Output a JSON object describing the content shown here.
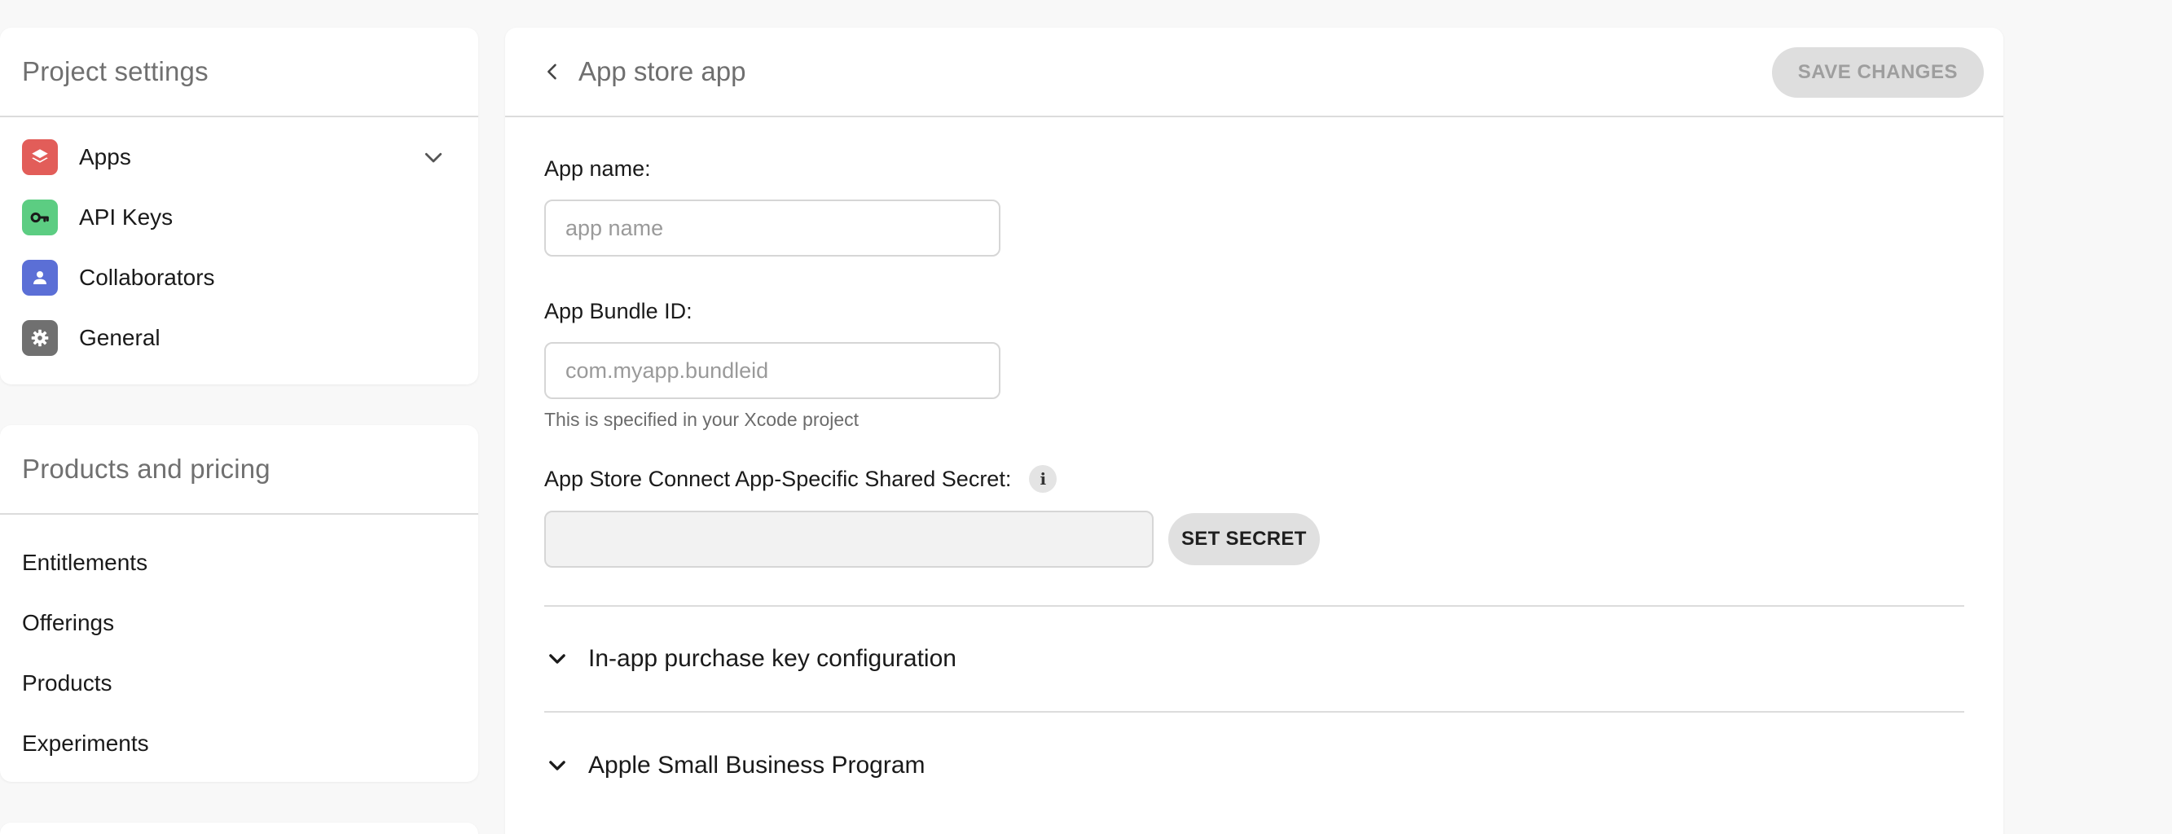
{
  "sidebar": {
    "project_settings": {
      "title": "Project settings",
      "items": [
        {
          "label": "Apps",
          "icon": "apps-stack-icon",
          "color": "#e25d59"
        },
        {
          "label": "API Keys",
          "icon": "key-icon",
          "color": "#5ccd82"
        },
        {
          "label": "Collaborators",
          "icon": "person-icon",
          "color": "#5b6fd6"
        },
        {
          "label": "General",
          "icon": "gear-icon",
          "color": "#707070"
        }
      ]
    },
    "products_pricing": {
      "title": "Products and pricing",
      "items": [
        {
          "label": "Entitlements"
        },
        {
          "label": "Offerings"
        },
        {
          "label": "Products"
        },
        {
          "label": "Experiments"
        }
      ]
    }
  },
  "main": {
    "title": "App store app",
    "save_label": "SAVE CHANGES",
    "fields": {
      "app_name": {
        "label": "App name:",
        "placeholder": "app name",
        "value": ""
      },
      "bundle_id": {
        "label": "App Bundle ID:",
        "placeholder": "com.myapp.bundleid",
        "value": "",
        "hint": "This is specified in your Xcode project"
      },
      "shared_secret": {
        "label": "App Store Connect App-Specific Shared Secret:",
        "info": "i",
        "button_label": "SET SECRET"
      }
    },
    "sections": [
      {
        "label": "In-app purchase key configuration"
      },
      {
        "label": "Apple Small Business Program"
      }
    ]
  }
}
